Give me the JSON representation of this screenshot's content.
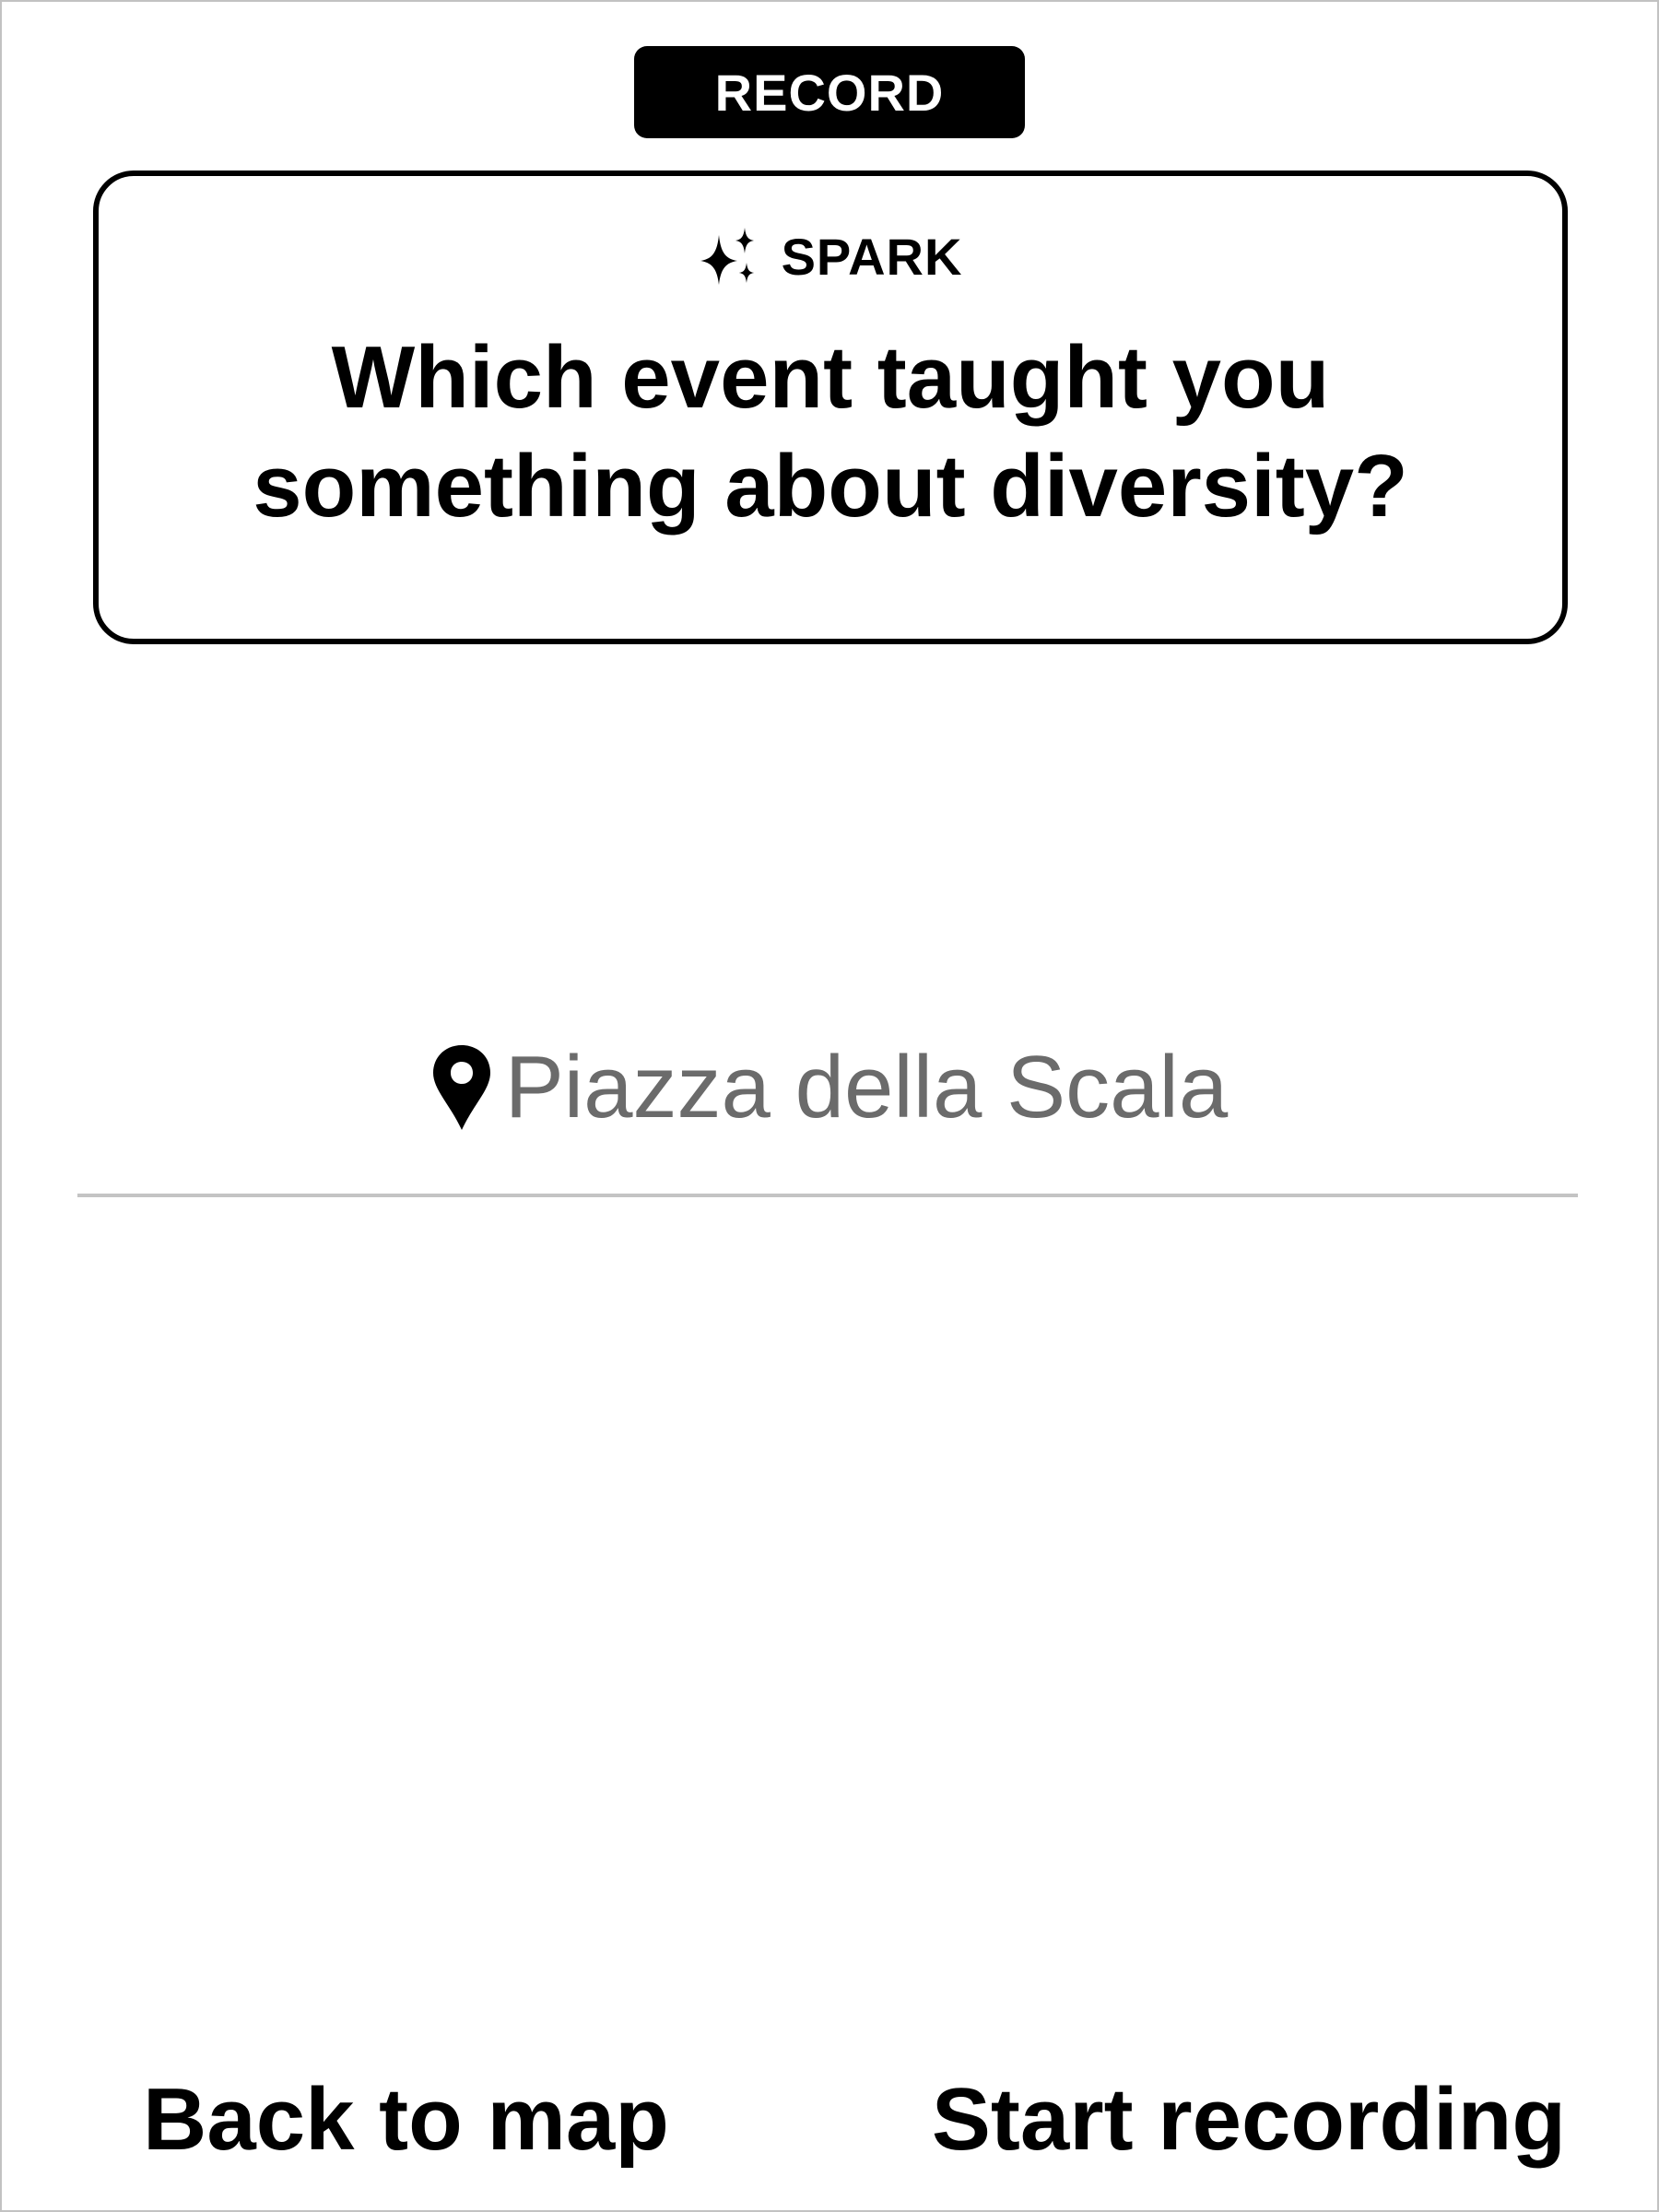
{
  "header": {
    "badge_label": "RECORD"
  },
  "spark_card": {
    "icon": "sparkle-icon",
    "label": "SPARK",
    "question": "Which event taught you something about diversity?"
  },
  "location": {
    "icon": "map-pin-icon",
    "name": "Piazza della Scala"
  },
  "footer": {
    "back_label": "Back to map",
    "start_label": "Start recording"
  },
  "colors": {
    "background": "#ffffff",
    "foreground": "#000000",
    "location_text": "#6b6b6b",
    "divider": "#c4c4c4"
  }
}
